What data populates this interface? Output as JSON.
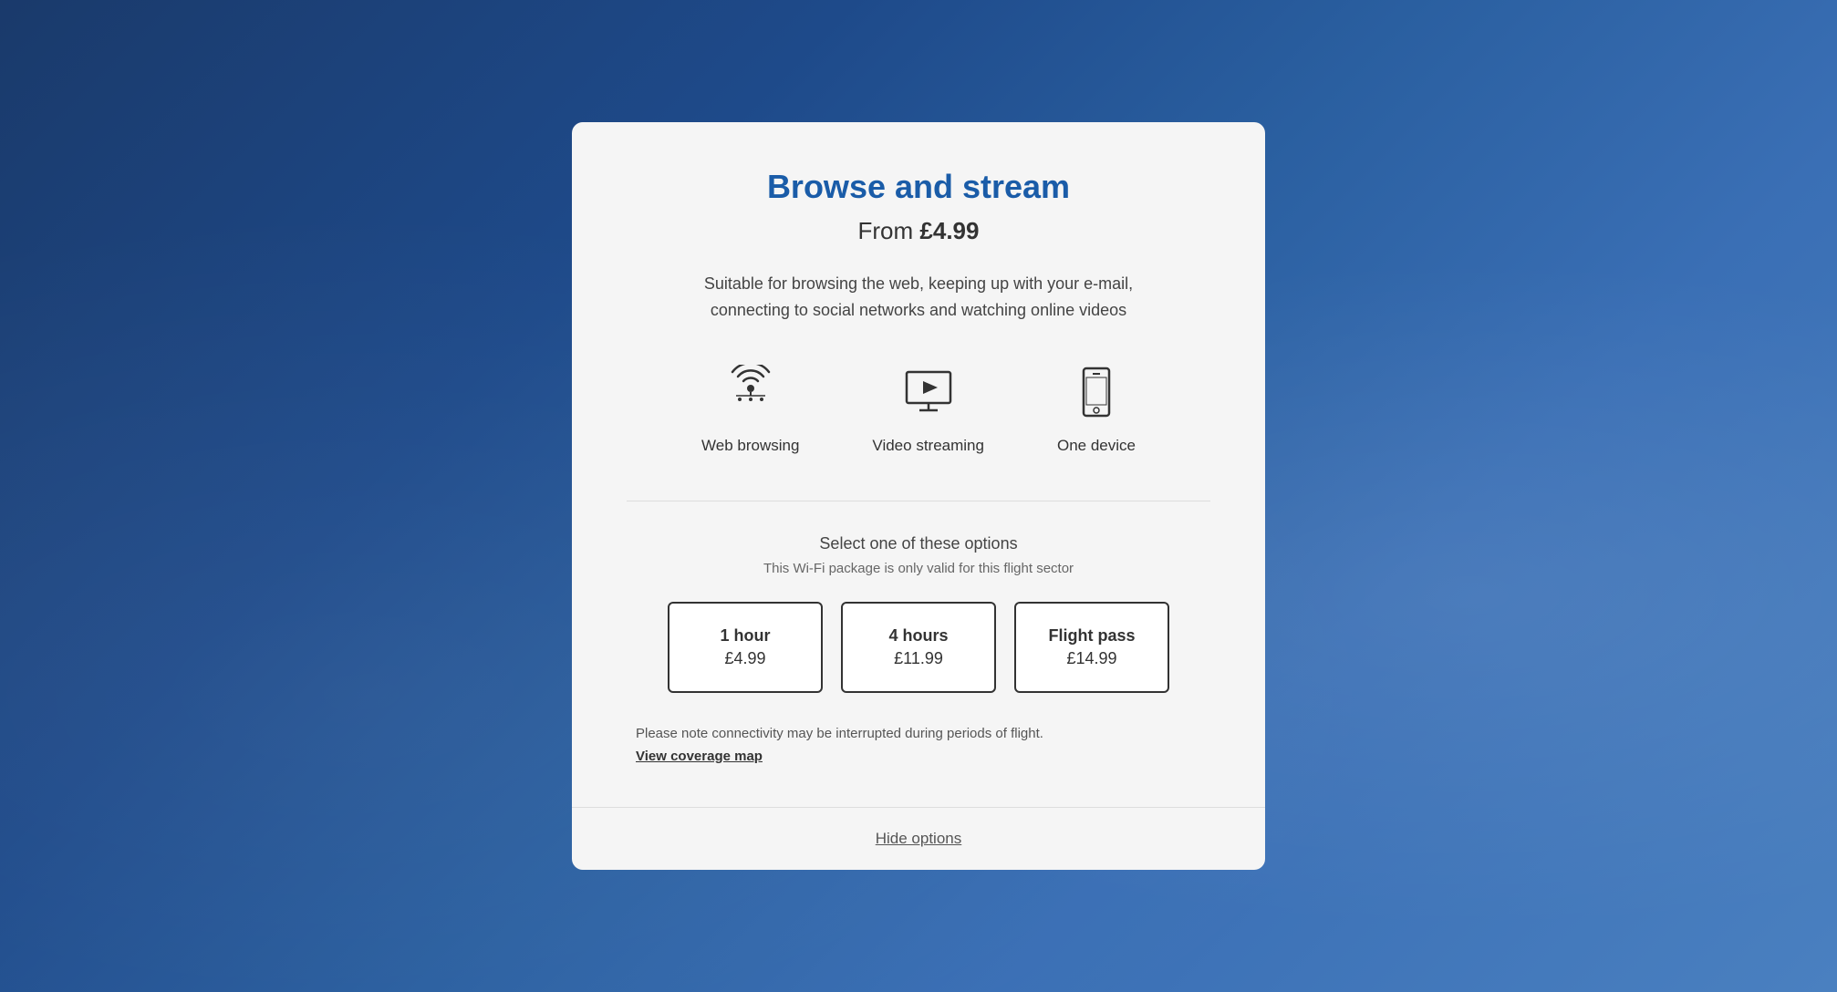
{
  "modal": {
    "title": "Browse and stream",
    "price_prefix": "From ",
    "price": "£4.99",
    "description": "Suitable for browsing the web, keeping up with your e-mail, connecting to social networks and watching online videos",
    "features": [
      {
        "id": "web-browsing",
        "label": "Web browsing",
        "icon": "browsing"
      },
      {
        "id": "video-streaming",
        "label": "Video streaming",
        "icon": "streaming"
      },
      {
        "id": "one-device",
        "label": "One device",
        "icon": "device"
      }
    ],
    "select_title": "Select one of these options",
    "select_subtitle": "This Wi-Fi package is only valid for this flight sector",
    "options": [
      {
        "id": "1hour",
        "duration": "1 hour",
        "price": "£4.99"
      },
      {
        "id": "4hours",
        "duration": "4 hours",
        "price": "£11.99"
      },
      {
        "id": "flight-pass",
        "duration": "Flight pass",
        "price": "£14.99"
      }
    ],
    "connectivity_note": "Please note connectivity may be interrupted during periods of flight.",
    "coverage_link": "View coverage map",
    "hide_options": "Hide options"
  }
}
